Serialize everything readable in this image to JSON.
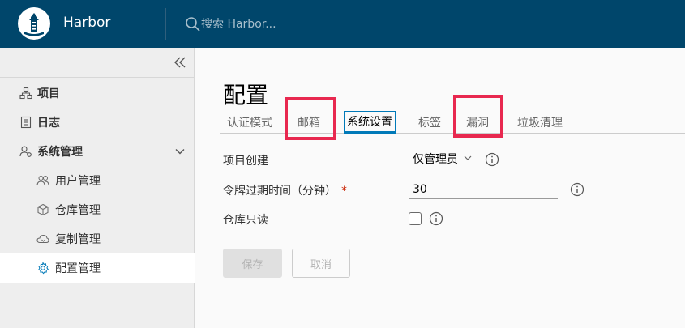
{
  "header": {
    "app_title": "Harbor",
    "search_placeholder": "搜索 Harbor...",
    "bg_color": "#00466b"
  },
  "sidebar": {
    "items": [
      {
        "label": "项目",
        "icon": "project-icon"
      },
      {
        "label": "日志",
        "icon": "log-icon"
      },
      {
        "label": "系统管理",
        "icon": "admin-icon"
      }
    ],
    "sub_items": [
      {
        "label": "用户管理",
        "icon": "users-icon"
      },
      {
        "label": "仓库管理",
        "icon": "registry-icon"
      },
      {
        "label": "复制管理",
        "icon": "replication-icon"
      },
      {
        "label": "配置管理",
        "icon": "gear-icon",
        "active": true
      }
    ]
  },
  "main": {
    "title": "配置",
    "tabs": [
      {
        "label": "认证模式"
      },
      {
        "label": "邮箱"
      },
      {
        "label": "系统设置",
        "active": true
      },
      {
        "label": "标签"
      },
      {
        "label": "漏洞"
      },
      {
        "label": "垃圾清理"
      }
    ],
    "form": {
      "project_creation_label": "项目创建",
      "project_creation_value": "仅管理员",
      "token_expiry_label": "令牌过期时间（分钟）",
      "token_expiry_required": "*",
      "token_expiry_value": "30",
      "registry_readonly_label": "仓库只读"
    },
    "buttons": {
      "save": "保存",
      "cancel": "取消"
    }
  },
  "colors": {
    "accent": "#0079b8",
    "highlight": "#e8284f"
  }
}
